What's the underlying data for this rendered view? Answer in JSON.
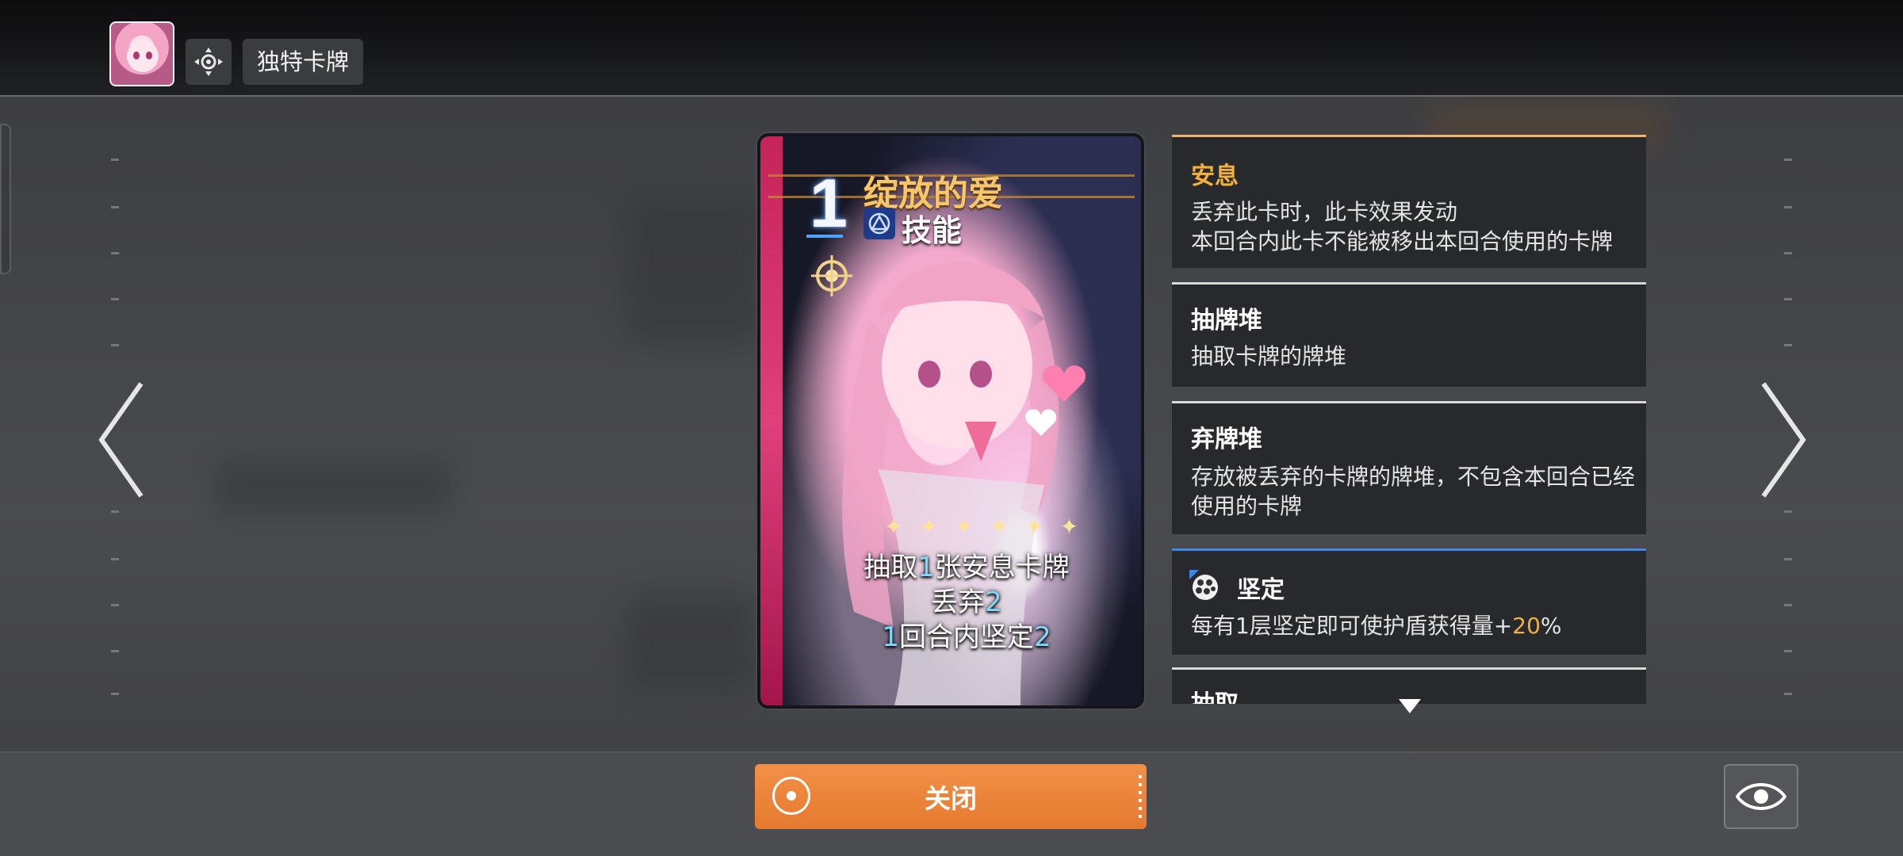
{
  "header": {
    "avatar_icon": "character-portrait",
    "mode_icon": "target-icon",
    "tag_label": "独特卡牌"
  },
  "card": {
    "cost": "1",
    "name": "绽放的爱",
    "type_icon": "skill-type-icon",
    "type_label": "技能",
    "lines": [
      {
        "pre": "抽取",
        "num": "1",
        "post": "张安息卡牌"
      },
      {
        "pre": "丢弃",
        "num": "2",
        "post": ""
      },
      {
        "num1": "1",
        "mid": "回合内坚定",
        "num2": "2"
      }
    ]
  },
  "keywords": [
    {
      "title": "安息",
      "desc": "丢弃此卡时，此卡效果发动\n本回合内此卡不能被移出本回合使用的卡牌"
    },
    {
      "title": "抽牌堆",
      "desc": "抽取卡牌的牌堆"
    },
    {
      "title": "弃牌堆",
      "desc": "存放被丢弃的卡牌的牌堆，不包含本回合已经使用的卡牌"
    },
    {
      "title": "坚定",
      "icon": "shield-dots-icon",
      "desc_pre": "每有1层坚定即可使护盾获得量+",
      "desc_hl": "20",
      "desc_post": "%"
    },
    {
      "title": "抽取"
    }
  ],
  "footer": {
    "close_label": "关闭",
    "eye_icon": "eye-icon"
  },
  "colors": {
    "accent_orange": "#e57a2f",
    "gold": "#f7c56a",
    "number_blue": "#7fd7ff",
    "highlight": "#f2b13a"
  }
}
